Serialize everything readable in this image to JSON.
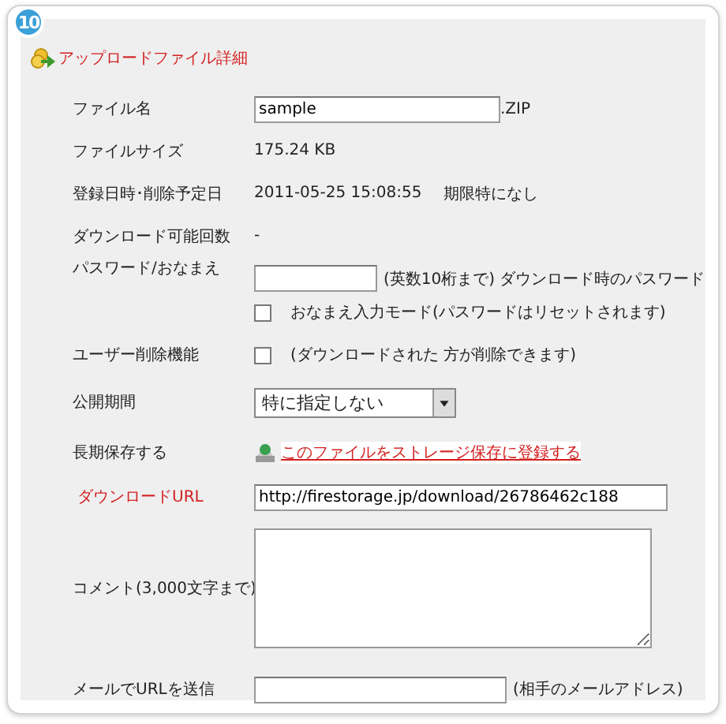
{
  "badge": "10",
  "title": "アップロードファイル詳細",
  "rows": [
    {
      "kind": "filename",
      "label": "ファイル名",
      "value": "sample",
      "suffix": ".ZIP"
    },
    {
      "kind": "text",
      "label": "ファイルサイズ",
      "values": [
        "175.24 KB"
      ]
    },
    {
      "kind": "text",
      "label": "登録日時･削除予定日",
      "values": [
        "2011-05-25 15:08:55",
        "期限特になし"
      ]
    },
    {
      "kind": "text",
      "label": "ダウンロード可能回数",
      "values": [
        "-"
      ]
    },
    {
      "kind": "password",
      "label": "パスワード/おなまえ",
      "note": "(英数10桁まで) ダウンロード時のパスワード",
      "checkbox": {
        "label": "おなまえ入力モード(パスワードはリセットされます)",
        "checked": false
      }
    },
    {
      "kind": "checkbox",
      "label": "ユーザー削除機能",
      "checked": false,
      "note": "(ダウンロードされた 方が削除できます)"
    },
    {
      "kind": "select",
      "label": "公開期間",
      "value": "特に指定しない"
    },
    {
      "kind": "link",
      "label": "長期保存する",
      "link": "このファイルをストレージ保存に登録する"
    },
    {
      "kind": "url",
      "label": "ダウンロードURL",
      "highlight": true,
      "value": "http://firestorage.jp/download/26786462c188"
    },
    {
      "kind": "textarea",
      "label": "コメント(3,000文字まで)"
    },
    {
      "kind": "email",
      "label": "メールでURLを送信",
      "note": "(相手のメールアドレス)"
    }
  ]
}
